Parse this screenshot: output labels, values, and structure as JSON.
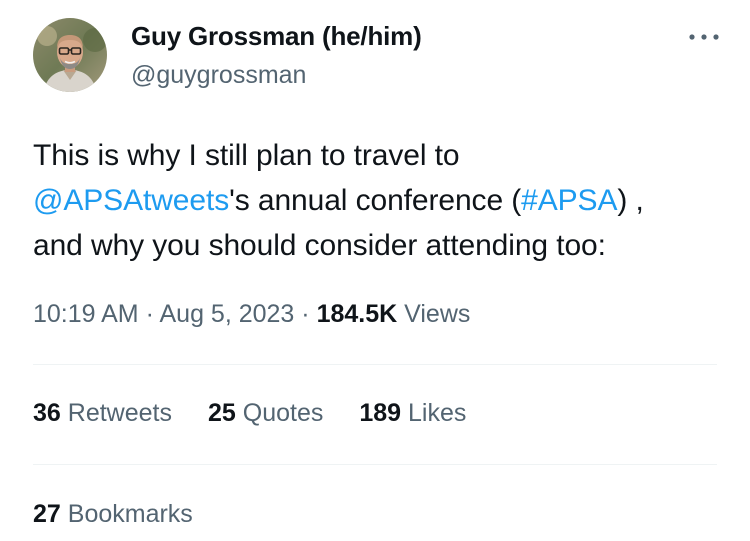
{
  "author": {
    "display_name": "Guy Grossman (he/him)",
    "handle": "@guygrossman",
    "avatar_icon": "profile-photo"
  },
  "more_icon": "more-horizontal-icon",
  "tweet": {
    "line1": "This is why I still plan to travel to",
    "mention": "@APSAtweets",
    "line2_mid": "'s annual conference (",
    "hashtag": "#APSA",
    "line2_end": ") ,",
    "line3": "and why you should consider attending too:"
  },
  "meta": {
    "time": "10:19 AM",
    "separator": "·",
    "date": "Aug 5, 2023",
    "views_count": "184.5K",
    "views_label": "Views"
  },
  "stats": {
    "retweets_count": "36",
    "retweets_label": "Retweets",
    "quotes_count": "25",
    "quotes_label": "Quotes",
    "likes_count": "189",
    "likes_label": "Likes",
    "bookmarks_count": "27",
    "bookmarks_label": "Bookmarks"
  },
  "colors": {
    "link": "#1d9bf0",
    "secondary_text": "#536471",
    "primary_text": "#0f1419",
    "divider": "#eff3f4"
  }
}
